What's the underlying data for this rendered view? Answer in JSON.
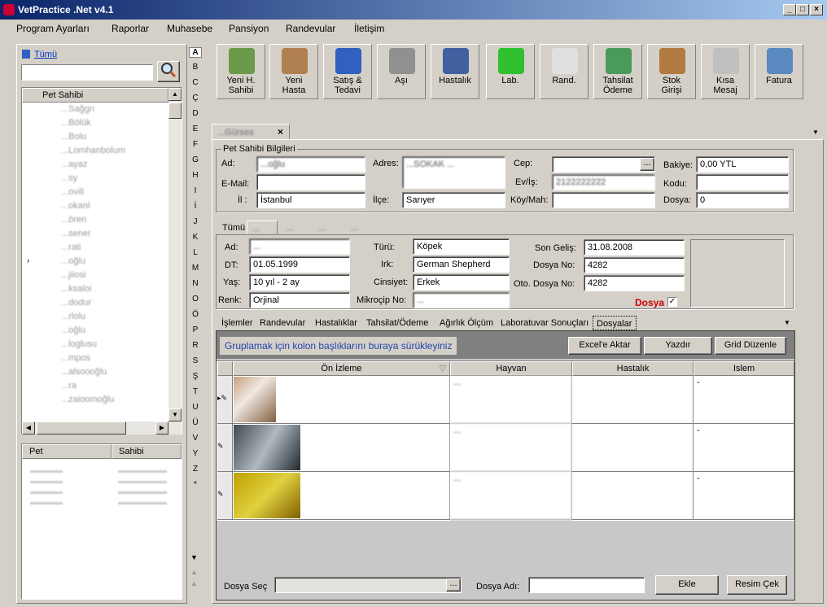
{
  "window": {
    "title": "VetPractice .Net v4.1"
  },
  "menu": [
    "Program Ayarları",
    "Raporlar",
    "Muhasebe",
    "Pansiyon",
    "Randevular",
    "İletişim"
  ],
  "toolbar": [
    {
      "label1": "Yeni H.",
      "label2": "Sahibi",
      "icon": "people-icon",
      "color": "#6a9a4a"
    },
    {
      "label1": "Yeni",
      "label2": "Hasta",
      "icon": "dog-icon",
      "color": "#b08050"
    },
    {
      "label1": "Satış &",
      "label2": "Tedavi",
      "icon": "pills-icon",
      "color": "#3060c0"
    },
    {
      "label1": "",
      "label2": "Aşı",
      "icon": "syringe-icon",
      "color": "#909090"
    },
    {
      "label1": "",
      "label2": "Hastalık",
      "icon": "stethoscope-icon",
      "color": "#4060a0"
    },
    {
      "label1": "",
      "label2": "Lab.",
      "icon": "flask-icon",
      "color": "#30c030"
    },
    {
      "label1": "",
      "label2": "Rand.",
      "icon": "clock-icon",
      "color": "#e0e0e0"
    },
    {
      "label1": "Tahsilat",
      "label2": "Ödeme",
      "icon": "money-icon",
      "color": "#4a9a5a"
    },
    {
      "label1": "Stok",
      "label2": "Girişi",
      "icon": "box-icon",
      "color": "#b07a40"
    },
    {
      "label1": "Kısa",
      "label2": "Mesaj",
      "icon": "envelope-icon",
      "color": "#c0c0c0"
    },
    {
      "label1": "",
      "label2": "Fatura",
      "icon": "cash-register-icon",
      "color": "#5a8ac0"
    }
  ],
  "left": {
    "all_link": "Tümü",
    "search_placeholder": "",
    "list_header": "Pet Sahibi",
    "owners": [
      "...Sağgrı",
      "...Bölük",
      "...Bolu",
      "...Lomhanbolum",
      "...ayaz",
      "...sy",
      "...ovili",
      "...okanl",
      "...ören",
      "...sener",
      "...rati",
      "...oğlu",
      "...jiiosi",
      "...ksaloi",
      "...dodur",
      "...rlolu",
      "...oğlu",
      "...loglusu",
      "...mpos",
      "...alsoooğlu",
      "...ra",
      "...zaioomoğlu"
    ],
    "bottom_headers": [
      "Pet",
      "Sahibi"
    ],
    "alphabet": [
      "A",
      "B",
      "C",
      "Ç",
      "D",
      "E",
      "F",
      "G",
      "H",
      "I",
      "İ",
      "J",
      "K",
      "L",
      "M",
      "N",
      "O",
      "Ö",
      "P",
      "R",
      "S",
      "Ş",
      "T",
      "U",
      "Ü",
      "V",
      "Y",
      "Z",
      "*"
    ]
  },
  "doc_tab": {
    "title": "...Gürses"
  },
  "owner": {
    "section_title": "Pet Sahibi Bilgileri",
    "ad_label": "Ad:",
    "ad_value": "...oğlu",
    "email_label": "E-Mail:",
    "email_value": "",
    "il_label": "İl :",
    "il_value": "İstanbul",
    "adres_label": "Adres:",
    "adres_value": "...SOKAK ...",
    "ilce_label": "İlçe:",
    "ilce_value": "Sarıyer",
    "cep_label": "Cep:",
    "cep_value": "",
    "evis_label": "Ev/İş:",
    "evis_value": "2122222222",
    "koy_label": "Köy/Mah:",
    "koy_value": "",
    "bakiye_label": "Bakiye:",
    "bakiye_value": "0,00 YTL",
    "kodu_label": "Kodu:",
    "kodu_value": "",
    "dosya_label": "Dosya:",
    "dosya_value": "0"
  },
  "pet_tabs": [
    "Tümü",
    "...",
    "...",
    "...",
    "..."
  ],
  "pet": {
    "ad_label": "Ad:",
    "ad_value": "...",
    "dt_label": "DT:",
    "dt_value": "01.05.1999",
    "yas_label": "Yaş:",
    "yas_value": "10 yıl - 2 ay",
    "renk_label": "Renk:",
    "renk_value": "Orjinal",
    "turu_label": "Türü:",
    "turu_value": "Köpek",
    "irk_label": "Irk:",
    "irk_value": "German Shepherd",
    "cinsiyet_label": "Cinsiyet:",
    "cinsiyet_value": "Erkek",
    "mikrocip_label": "Mikroçip No:",
    "mikrocip_value": "...",
    "songelis_label": "Son Geliş:",
    "songelis_value": "31.08.2008",
    "dosyano_label": "Dosya No:",
    "dosyano_value": "4282",
    "otodosya_label": "Oto. Dosya No:",
    "otodosya_value": "4282",
    "dosya_check_label": "Dosya"
  },
  "sub_tabs": [
    "İşlemler",
    "Randevular",
    "Hastalıklar",
    "Tahsilat/Ödeme",
    "Ağırlık Ölçüm",
    "Laboratuvar Sonuçları",
    "Dosyalar"
  ],
  "files": {
    "group_hint": "Gruplamak için kolon başlıklarını buraya sürükleyiniz",
    "excel_btn": "Excel'e Aktar",
    "print_btn": "Yazdır",
    "grid_btn": "Grid Düzenle",
    "columns": [
      "Ön İzleme",
      "Hayvan",
      "Hastalık",
      "Islem"
    ],
    "rows": [
      {
        "hayvan": "...",
        "hastalik": "",
        "islem": "-"
      },
      {
        "hayvan": "...",
        "hastalik": "",
        "islem": "-"
      },
      {
        "hayvan": "...",
        "hastalik": "",
        "islem": "-"
      }
    ],
    "dosya_sec_label": "Dosya Seç",
    "dosya_adi_label": "Dosya Adı:",
    "ekle_btn": "Ekle",
    "resim_btn": "Resim Çek"
  }
}
